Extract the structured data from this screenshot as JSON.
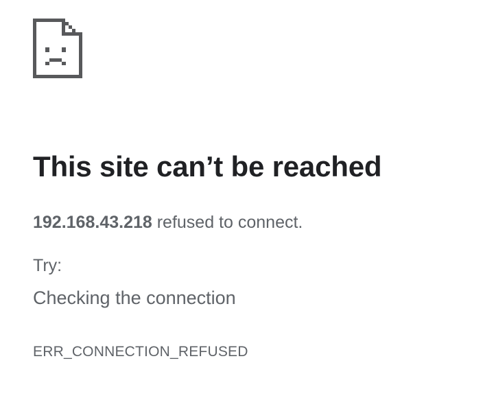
{
  "error_page": {
    "icon": "sad-page-icon",
    "title": "This site can’t be reached",
    "host": "192.168.43.218",
    "summary_suffix": " refused to connect.",
    "try_label": "Try:",
    "suggestions": [
      "Checking the connection"
    ],
    "error_code": "ERR_CONNECTION_REFUSED"
  },
  "colors": {
    "title": "#202124",
    "body_text": "#5f6368",
    "icon": "#5f6368",
    "background": "#ffffff"
  }
}
